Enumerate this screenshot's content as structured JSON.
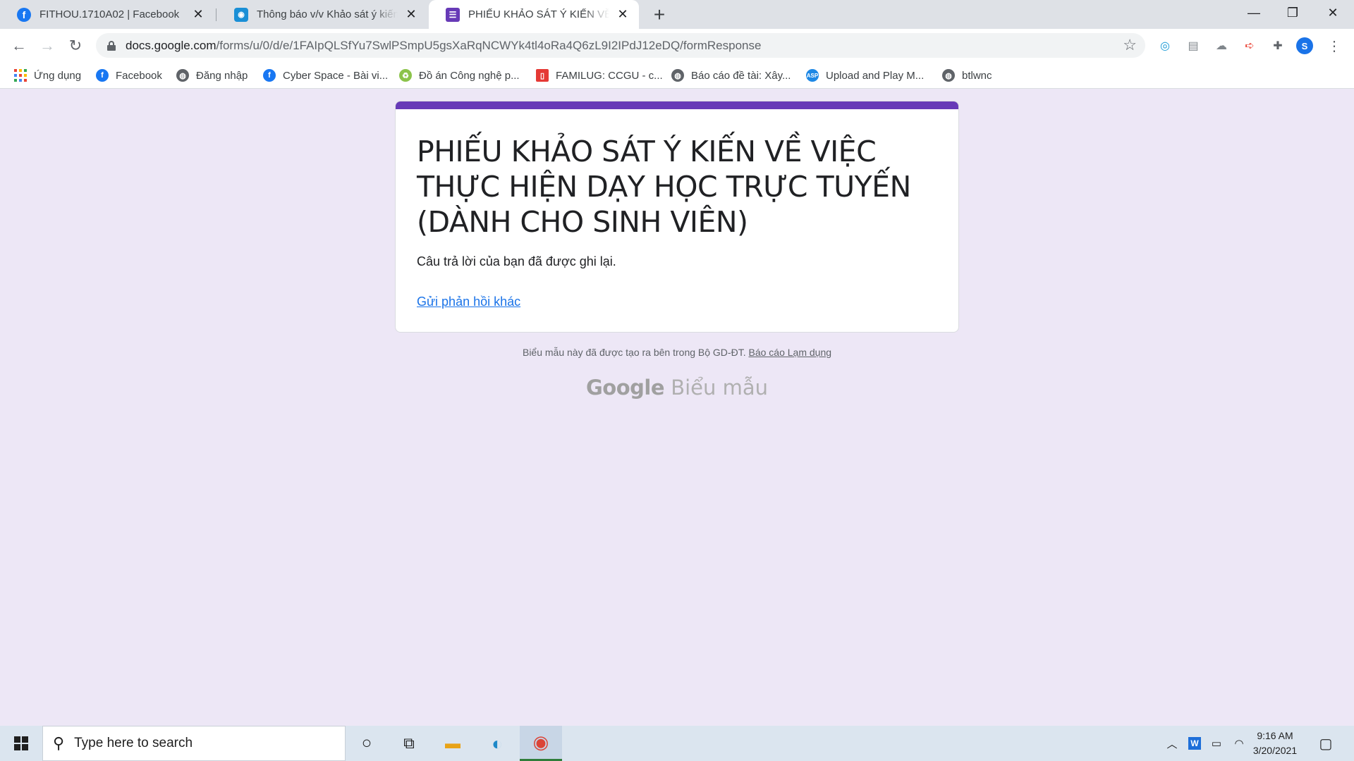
{
  "browser": {
    "tabs": [
      {
        "title": "FITHOU.1710A02 | Facebook",
        "close": "✕"
      },
      {
        "title": "Thông báo v/v Khảo sát ý kiến Sinh viên",
        "close": "✕"
      },
      {
        "title": "PHIẾU KHẢO SÁT Ý KIẾN VỀ VIỆC THỰC HIỆN",
        "close": "✕"
      }
    ],
    "new_tab": "+",
    "window_controls": {
      "minimize": "—",
      "restore": "❐",
      "close": "✕"
    },
    "url": {
      "host": "docs.google.com",
      "path": "/forms/u/0/d/e/1FAIpQLSfYu7SwlPSmpU5gsXaRqNCWYk4tl4oRa4Q6zL9I2IPdJ12eDQ/formResponse"
    },
    "bookmarks": [
      {
        "label": "Ứng dụng",
        "icon": "apps-grid-icon"
      },
      {
        "label": "Facebook",
        "icon": "facebook-icon"
      },
      {
        "label": "Đăng nhập",
        "icon": "globe-icon"
      },
      {
        "label": "Cyber Space - Bài vi...",
        "icon": "facebook-icon"
      },
      {
        "label": "Đồ án Công nghệ p...",
        "icon": "recycle-icon"
      },
      {
        "label": "FAMILUG: CCGU - c...",
        "icon": "bookmark-icon"
      },
      {
        "label": "Báo cáo đề tài: Xây...",
        "icon": "globe-icon"
      },
      {
        "label": "Upload and Play M...",
        "icon": "asp-icon"
      },
      {
        "label": "btlwnc",
        "icon": "globe-icon"
      }
    ]
  },
  "form": {
    "title": "PHIẾU KHẢO SÁT Ý KIẾN VỀ VIỆC THỰC HIỆN DẠY HỌC TRỰC TUYẾN (DÀNH CHO SINH VIÊN)",
    "confirmation": "Câu trả lời của bạn đã được ghi lại.",
    "submit_another": "Gửi phản hồi khác",
    "accent_color": "#673ab7"
  },
  "footer": {
    "note": "Biểu mẫu này đã được tạo ra bên trong Bộ GD-ĐT.",
    "report_link": "Báo cáo Lạm dụng",
    "brand_google": "Google",
    "brand_forms": "Biểu mẫu"
  },
  "taskbar": {
    "search_placeholder": "Type here to search",
    "time": "9:16 AM",
    "date": "3/20/2021"
  },
  "colors": {
    "page_background": "#ede7f6",
    "link": "#1a73e8"
  }
}
